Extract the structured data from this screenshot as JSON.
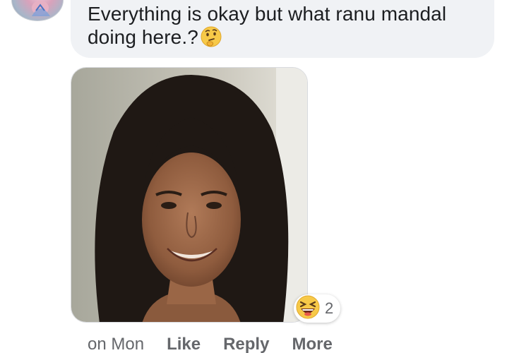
{
  "comment": {
    "text": "Everything is okay but what ranu mandal doing here.?",
    "inline_emoji": "thinking-face-icon",
    "attachment_image": "photo of smiling woman with long dark hair"
  },
  "reaction": {
    "emoji": "laughing-face-icon",
    "count": "2"
  },
  "actions": {
    "time": "on Mon",
    "like": "Like",
    "reply": "Reply",
    "more": "More"
  },
  "colors": {
    "bubble": "#f0f2f5",
    "text": "#1c1e21",
    "meta": "#65676b"
  }
}
